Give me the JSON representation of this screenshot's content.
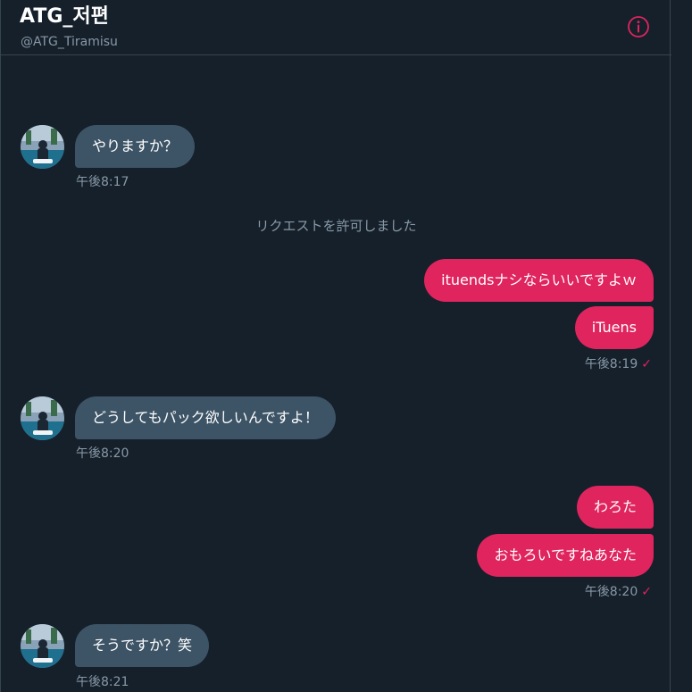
{
  "header": {
    "title": "ATG_저편",
    "handle": "@ATG_Tiramisu",
    "info_icon": "info-circle-icon"
  },
  "colors": {
    "background": "#15202b",
    "incoming_bubble": "#3d5466",
    "outgoing_bubble": "#e0245e",
    "secondary_text": "#8899a6",
    "border": "#38444d"
  },
  "conversation": {
    "messages": [
      {
        "direction": "in",
        "text": "やりますか？",
        "time": "午後8:17"
      },
      {
        "direction": "system",
        "text": "リクエストを許可しました"
      },
      {
        "direction": "out",
        "text": "ituendsナシならいいですよｗ"
      },
      {
        "direction": "out",
        "text": "iTuens",
        "time": "午後8:19"
      },
      {
        "direction": "in",
        "text": "どうしてもパック欲しいんですよ！",
        "time": "午後8:20"
      },
      {
        "direction": "out",
        "text": "わろた"
      },
      {
        "direction": "out",
        "text": "おもろいですねあなた",
        "time": "午後8:20"
      },
      {
        "direction": "in",
        "text": "そうですか？笑",
        "time": "午後8:21"
      }
    ],
    "read_check": "✓"
  }
}
